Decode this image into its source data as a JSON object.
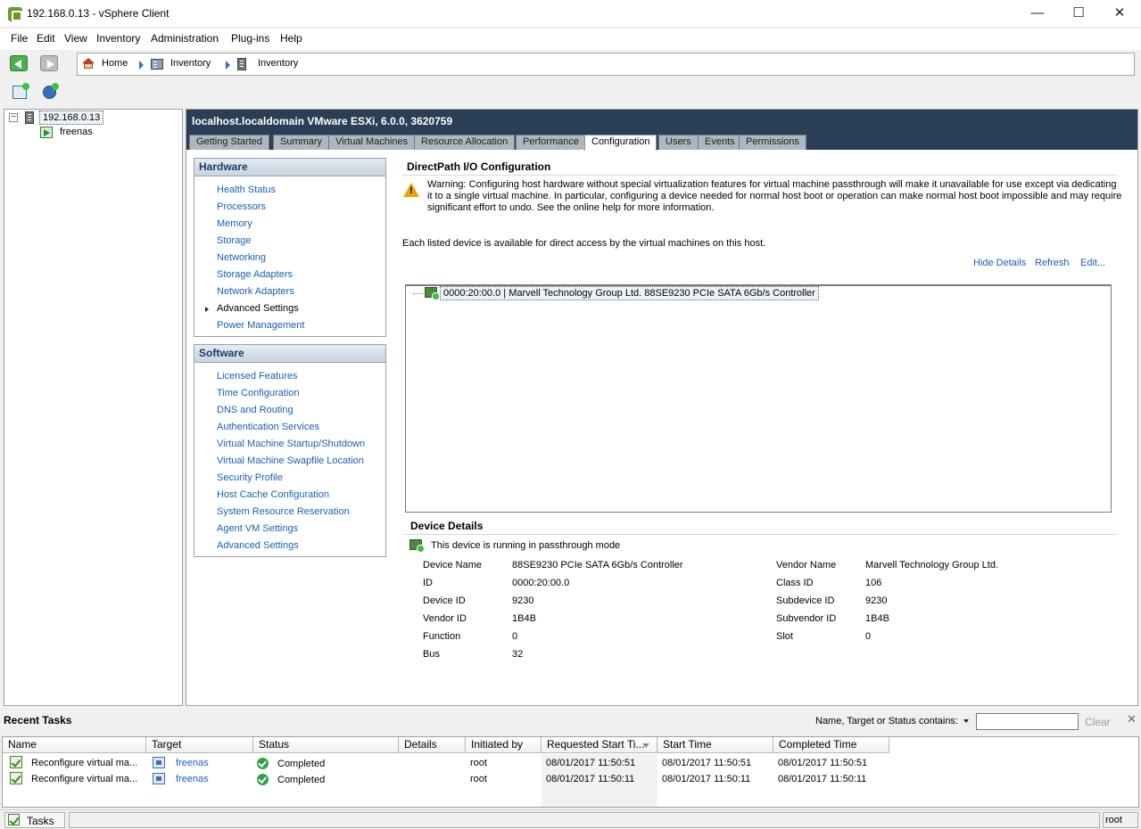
{
  "window": {
    "title": "192.168.0.13 - vSphere Client",
    "controls": {
      "minimize": "—",
      "maximize": "☐",
      "close": "✕"
    }
  },
  "menu": [
    "File",
    "Edit",
    "View",
    "Inventory",
    "Administration",
    "Plug-ins",
    "Help"
  ],
  "breadcrumb": {
    "home": "Home",
    "inventory1": "Inventory",
    "inventory2": "Inventory"
  },
  "tree": {
    "host": "192.168.0.13",
    "vm": "freenas",
    "collapse": "−"
  },
  "host_header": "localhost.localdomain VMware ESXi, 6.0.0, 3620759",
  "tabs": [
    "Getting Started",
    "Summary",
    "Virtual Machines",
    "Resource Allocation",
    "Performance",
    "Configuration",
    "Users",
    "Events",
    "Permissions"
  ],
  "active_tab": "Configuration",
  "hardware": {
    "title": "Hardware",
    "items": [
      "Health Status",
      "Processors",
      "Memory",
      "Storage",
      "Networking",
      "Storage Adapters",
      "Network Adapters",
      "Advanced Settings",
      "Power Management"
    ],
    "current": "Advanced Settings"
  },
  "software": {
    "title": "Software",
    "items": [
      "Licensed Features",
      "Time Configuration",
      "DNS and Routing",
      "Authentication Services",
      "Virtual Machine Startup/Shutdown",
      "Virtual Machine Swapfile Location",
      "Security Profile",
      "Host Cache Configuration",
      "System Resource Reservation",
      "Agent VM Settings",
      "Advanced Settings"
    ]
  },
  "directpath": {
    "title": "DirectPath I/O Configuration",
    "warning_l1": "Warning: Configuring host hardware without special virtualization features for virtual machine passthrough will make it unavailable for use except via dedicating",
    "warning_l2": "it to a single virtual machine. In particular, configuring a device needed for normal host boot or operation can make normal host boot impossible and may require",
    "warning_l3": "significant effort to undo. See the online help for more information.",
    "description": "Each listed device is available for direct access by the virtual machines on this host.",
    "actions": {
      "hide_details": "Hide Details",
      "refresh": "Refresh",
      "edit": "Edit..."
    },
    "device": "0000:20:00.0 | Marvell Technology Group Ltd. 88SE9230 PCIe SATA 6Gb/s Controller"
  },
  "device_details": {
    "title": "Device Details",
    "status": "This device is running in passthrough mode",
    "left": [
      {
        "label": "Device Name",
        "value": "88SE9230 PCIe SATA 6Gb/s Controller"
      },
      {
        "label": "ID",
        "value": "0000:20:00.0"
      },
      {
        "label": "Device ID",
        "value": "9230"
      },
      {
        "label": "Vendor ID",
        "value": "1B4B"
      },
      {
        "label": "Function",
        "value": "0"
      },
      {
        "label": "Bus",
        "value": "32"
      }
    ],
    "right": [
      {
        "label": "Vendor Name",
        "value": "Marvell Technology Group Ltd."
      },
      {
        "label": "Class ID",
        "value": "106"
      },
      {
        "label": "Subdevice ID",
        "value": "9230"
      },
      {
        "label": "Subvendor ID",
        "value": "1B4B"
      },
      {
        "label": "Slot",
        "value": "0"
      }
    ]
  },
  "recent_tasks": {
    "title": "Recent Tasks",
    "filter_label": "Name, Target or Status contains:",
    "filter_value": "",
    "clear": "Clear",
    "close": "✕",
    "columns": [
      "Name",
      "Target",
      "Status",
      "Details",
      "Initiated by",
      "Requested Start Ti...",
      "Start Time",
      "Completed Time"
    ],
    "rows": [
      {
        "name": "Reconfigure virtual ma...",
        "target": "freenas",
        "status": "Completed",
        "details": "",
        "initiated_by": "root",
        "requested": "08/01/2017 11:50:51",
        "start": "08/01/2017 11:50:51",
        "completed": "08/01/2017 11:50:51"
      },
      {
        "name": "Reconfigure virtual ma...",
        "target": "freenas",
        "status": "Completed",
        "details": "",
        "initiated_by": "root",
        "requested": "08/01/2017 11:50:11",
        "start": "08/01/2017 11:50:11",
        "completed": "08/01/2017 11:50:11"
      }
    ]
  },
  "statusbar": {
    "tasks": "Tasks",
    "user": "root"
  },
  "colors": {
    "header_bg": "#2a3f55",
    "link": "#1a5fb4",
    "success": "#2aa34a",
    "warning": "#e8a400"
  }
}
